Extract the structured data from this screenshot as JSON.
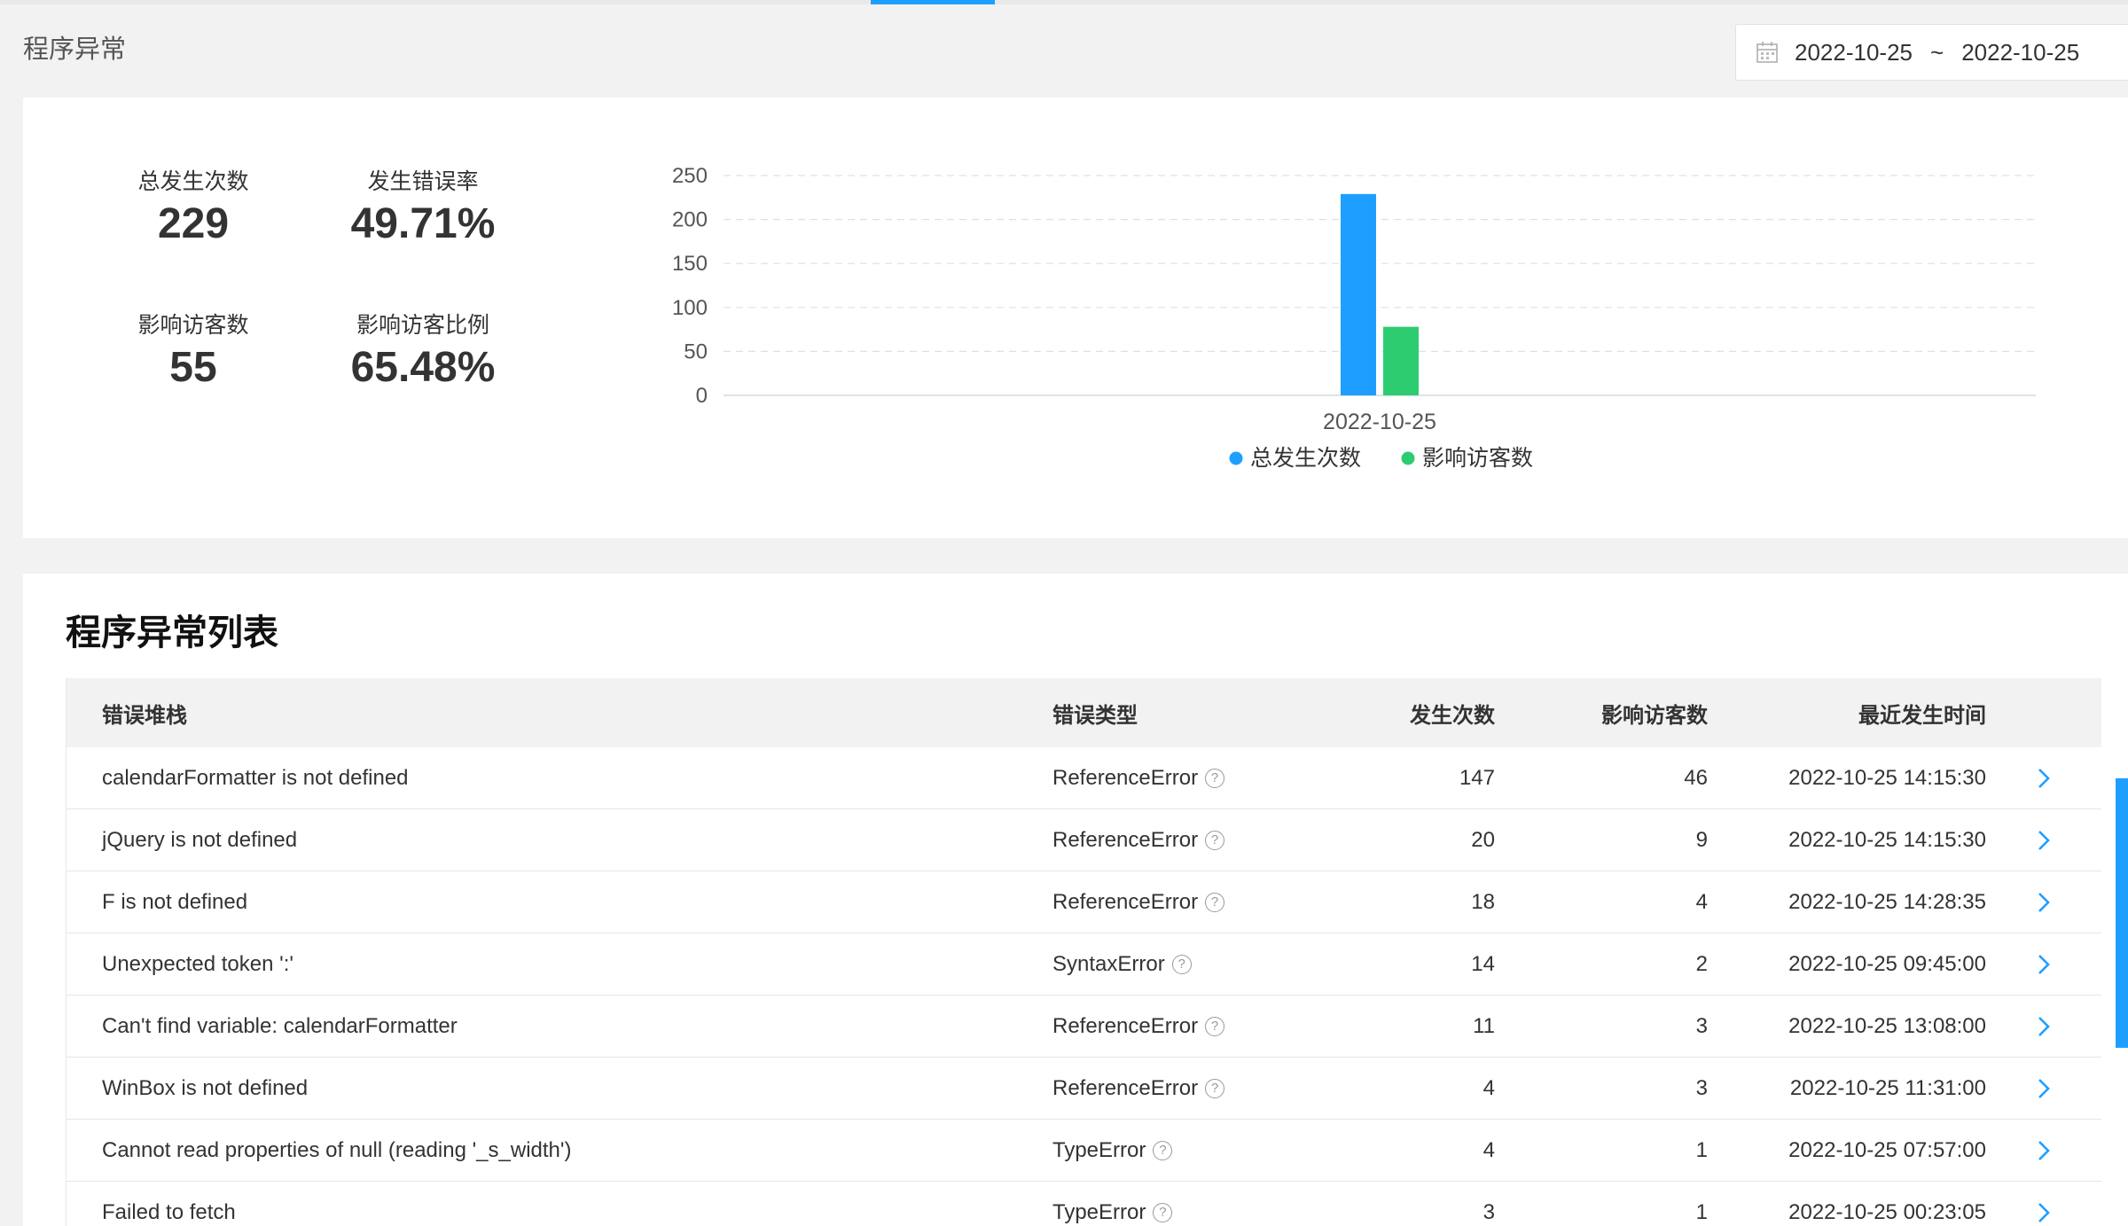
{
  "header": {
    "title": "程序异常"
  },
  "date_range": {
    "start": "2022-10-25",
    "separator": "~",
    "end": "2022-10-25"
  },
  "stats": {
    "total_label": "总发生次数",
    "total_value": "229",
    "rate_label": "发生错误率",
    "rate_value": "49.71%",
    "visitors_label": "影响访客数",
    "visitors_value": "55",
    "visitor_ratio_label": "影响访客比例",
    "visitor_ratio_value": "65.48%"
  },
  "chart_data": {
    "type": "bar",
    "categories": [
      "2022-10-25"
    ],
    "series": [
      {
        "name": "总发生次数",
        "values": [
          229
        ],
        "color": "#1e9fff"
      },
      {
        "name": "影响访客数",
        "values": [
          78
        ],
        "color": "#2ecc71"
      }
    ],
    "ylim": [
      0,
      250
    ],
    "yticks": [
      "0",
      "50",
      "100",
      "150",
      "200",
      "250"
    ],
    "grid": true,
    "legend_position": "bottom"
  },
  "list": {
    "title": "程序异常列表",
    "columns": {
      "stack": "错误堆栈",
      "type": "错误类型",
      "count": "发生次数",
      "visitors": "影响访客数",
      "time": "最近发生时间"
    },
    "rows": [
      {
        "stack": "calendarFormatter is not defined",
        "type": "ReferenceError",
        "count": "147",
        "visitors": "46",
        "time": "2022-10-25 14:15:30"
      },
      {
        "stack": "jQuery is not defined",
        "type": "ReferenceError",
        "count": "20",
        "visitors": "9",
        "time": "2022-10-25 14:15:30"
      },
      {
        "stack": "F is not defined",
        "type": "ReferenceError",
        "count": "18",
        "visitors": "4",
        "time": "2022-10-25 14:28:35"
      },
      {
        "stack": "Unexpected token ':'",
        "type": "SyntaxError",
        "count": "14",
        "visitors": "2",
        "time": "2022-10-25 09:45:00"
      },
      {
        "stack": "Can't find variable: calendarFormatter",
        "type": "ReferenceError",
        "count": "11",
        "visitors": "3",
        "time": "2022-10-25 13:08:00"
      },
      {
        "stack": "WinBox is not defined",
        "type": "ReferenceError",
        "count": "4",
        "visitors": "3",
        "time": "2022-10-25 11:31:00"
      },
      {
        "stack": "Cannot read properties of null (reading '_s_width')",
        "type": "TypeError",
        "count": "4",
        "visitors": "1",
        "time": "2022-10-25 07:57:00"
      },
      {
        "stack": "Failed to fetch",
        "type": "TypeError",
        "count": "3",
        "visitors": "1",
        "time": "2022-10-25 00:23:05"
      }
    ],
    "help_glyph": "?",
    "row_icon": "chevron-right-icon"
  },
  "colors": {
    "accent": "#1e9fff",
    "secondary": "#2ecc71"
  }
}
